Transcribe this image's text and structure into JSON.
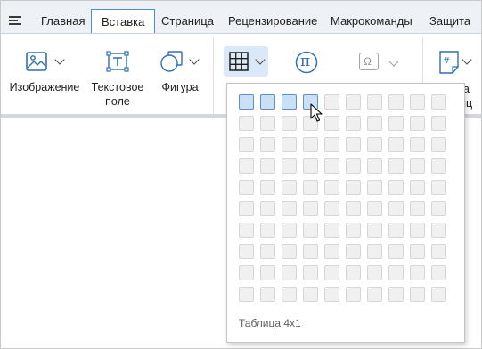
{
  "tabs": [
    {
      "label": "Главная"
    },
    {
      "label": "Вставка"
    },
    {
      "label": "Страница"
    },
    {
      "label": "Рецензирование"
    },
    {
      "label": "Макрокоманды"
    },
    {
      "label": "Защита"
    }
  ],
  "active_tab": "Вставка",
  "ribbon": {
    "image_label": "Изображение",
    "textbox_label_1": "Текстовое",
    "textbox_label_2": "поле",
    "shape_label": "Фигура",
    "formula_symbol": "π",
    "symbol_glyph": "Ω",
    "pagenum_partial_1": "ра",
    "pagenum_partial_2": "иц"
  },
  "table_picker": {
    "rows_total": 10,
    "cols_total": 10,
    "selected_cols": 4,
    "selected_rows": 1,
    "caption": "Таблица 4x1"
  },
  "colors": {
    "accent": "#4a8cd6",
    "tab_bar_bg": "#eef1f6",
    "selected_cell": "#c9e0f7",
    "selected_cell_border": "#5d8fc4",
    "table_button_bg": "#dbe8f7"
  },
  "icons": [
    "menu-icon",
    "image-icon",
    "textbox-icon",
    "shape-icon",
    "table-icon",
    "formula-icon",
    "symbol-icon",
    "page-number-icon",
    "mouse-cursor-icon"
  ]
}
